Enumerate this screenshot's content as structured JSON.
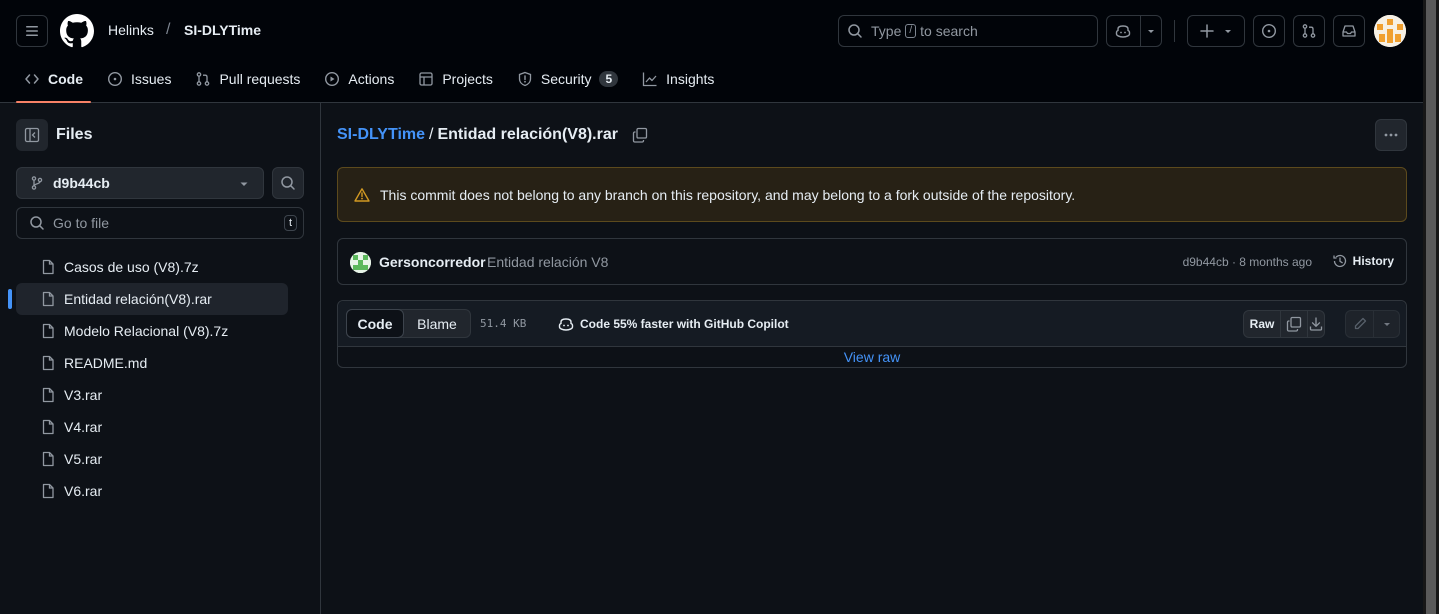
{
  "header": {
    "owner": "Helinks",
    "separator": "/",
    "repo": "SI-DLYTime",
    "search": {
      "before": "Type",
      "key": "/",
      "after": "to search"
    }
  },
  "nav": {
    "tabs": [
      {
        "label": "Code",
        "icon": "code-icon",
        "active": true
      },
      {
        "label": "Issues",
        "icon": "issue-icon"
      },
      {
        "label": "Pull requests",
        "icon": "pull-request-icon"
      },
      {
        "label": "Actions",
        "icon": "play-icon"
      },
      {
        "label": "Projects",
        "icon": "table-icon"
      },
      {
        "label": "Security",
        "icon": "shield-icon",
        "count": "5"
      },
      {
        "label": "Insights",
        "icon": "graph-icon"
      }
    ]
  },
  "sidebar": {
    "title": "Files",
    "branch": "d9b44cb",
    "go_to_file_placeholder": "Go to file",
    "go_to_file_key": "t",
    "files": [
      {
        "name": "Casos de uso (V8).7z"
      },
      {
        "name": "Entidad relación(V8).rar",
        "active": true
      },
      {
        "name": "Modelo Relacional (V8).7z"
      },
      {
        "name": "README.md"
      },
      {
        "name": "V3.rar"
      },
      {
        "name": "V4.rar"
      },
      {
        "name": "V5.rar"
      },
      {
        "name": "V6.rar"
      }
    ]
  },
  "main": {
    "path_repo": "SI-DLYTime",
    "path_sep": "/",
    "path_file": "Entidad relación(V8).rar",
    "warning": "This commit does not belong to any branch on this repository, and may belong to a fork outside of the repository.",
    "commit": {
      "author": "Gersoncorredor",
      "message": "Entidad relación V8",
      "meta": "d9b44cb · 8 months ago",
      "history_label": "History"
    },
    "file_toolbar": {
      "code_label": "Code",
      "blame_label": "Blame",
      "size": "51.4 KB",
      "copilot": "Code 55% faster with GitHub Copilot",
      "raw_label": "Raw"
    },
    "view_raw": "View raw"
  },
  "colors": {
    "background": "#0d1117",
    "header": "#010409",
    "link": "#4493f8",
    "active_tab_underline": "#f78166",
    "warning_bg": "#272115"
  }
}
